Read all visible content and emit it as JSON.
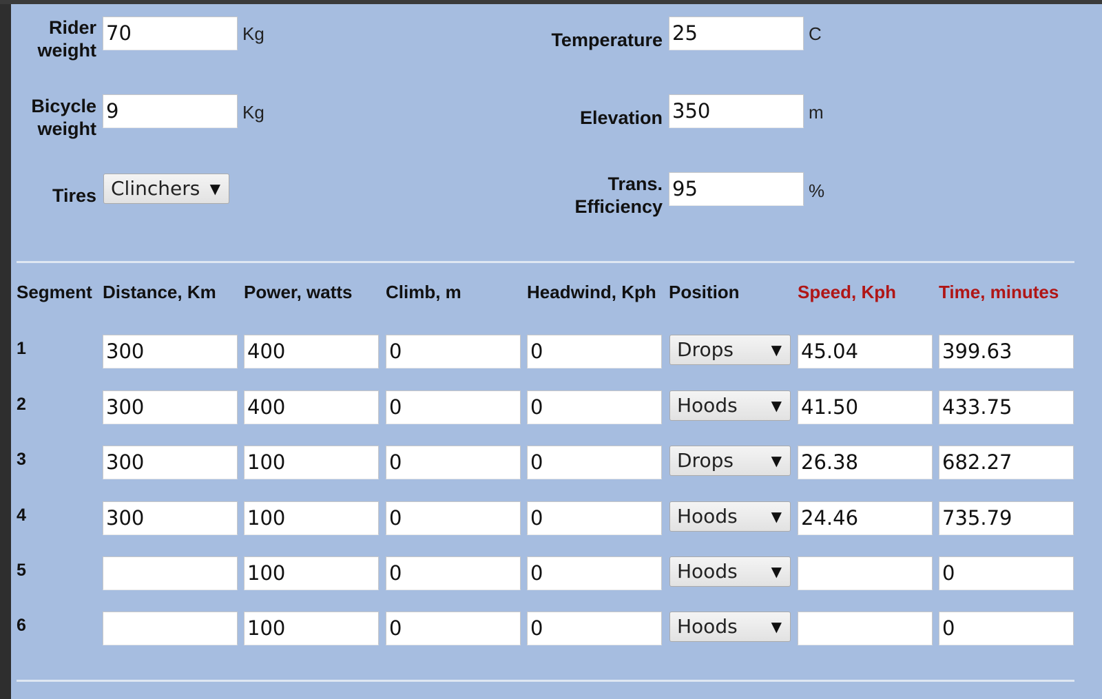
{
  "params": {
    "rider_weight": {
      "label_line1": "Rider",
      "label_line2": "weight",
      "value": "70",
      "unit": "Kg"
    },
    "bicycle_weight": {
      "label_line1": "Bicycle",
      "label_line2": "weight",
      "value": "9",
      "unit": "Kg"
    },
    "tires": {
      "label": "Tires",
      "selected": "Clinchers"
    },
    "temperature": {
      "label": "Temperature",
      "value": "25",
      "unit": "C"
    },
    "elevation": {
      "label": "Elevation",
      "value": "350",
      "unit": "m"
    },
    "trans_efficiency": {
      "label_line1": "Trans.",
      "label_line2": "Efficiency",
      "value": "95",
      "unit": "%"
    }
  },
  "table": {
    "headers": {
      "segment": "Segment",
      "distance": "Distance, Km",
      "power": "Power, watts",
      "climb": "Climb, m",
      "headwind": "Headwind, Kph",
      "position": "Position",
      "speed": "Speed, Kph",
      "time": "Time, minutes"
    },
    "rows": [
      {
        "segment": "1",
        "distance": "300",
        "power": "400",
        "climb": "0",
        "headwind": "0",
        "position": "Drops",
        "speed": "45.04",
        "time": "399.63"
      },
      {
        "segment": "2",
        "distance": "300",
        "power": "400",
        "climb": "0",
        "headwind": "0",
        "position": "Hoods",
        "speed": "41.50",
        "time": "433.75"
      },
      {
        "segment": "3",
        "distance": "300",
        "power": "100",
        "climb": "0",
        "headwind": "0",
        "position": "Drops",
        "speed": "26.38",
        "time": "682.27"
      },
      {
        "segment": "4",
        "distance": "300",
        "power": "100",
        "climb": "0",
        "headwind": "0",
        "position": "Hoods",
        "speed": "24.46",
        "time": "735.79"
      },
      {
        "segment": "5",
        "distance": "",
        "power": "100",
        "climb": "0",
        "headwind": "0",
        "position": "Hoods",
        "speed": "",
        "time": "0"
      },
      {
        "segment": "6",
        "distance": "",
        "power": "100",
        "climb": "0",
        "headwind": "0",
        "position": "Hoods",
        "speed": "",
        "time": "0"
      }
    ]
  },
  "icons": {
    "dropdown_arrow": "chevron-down-icon"
  },
  "colors": {
    "panel_bg": "#a6bde0",
    "result_header": "#b01616"
  }
}
